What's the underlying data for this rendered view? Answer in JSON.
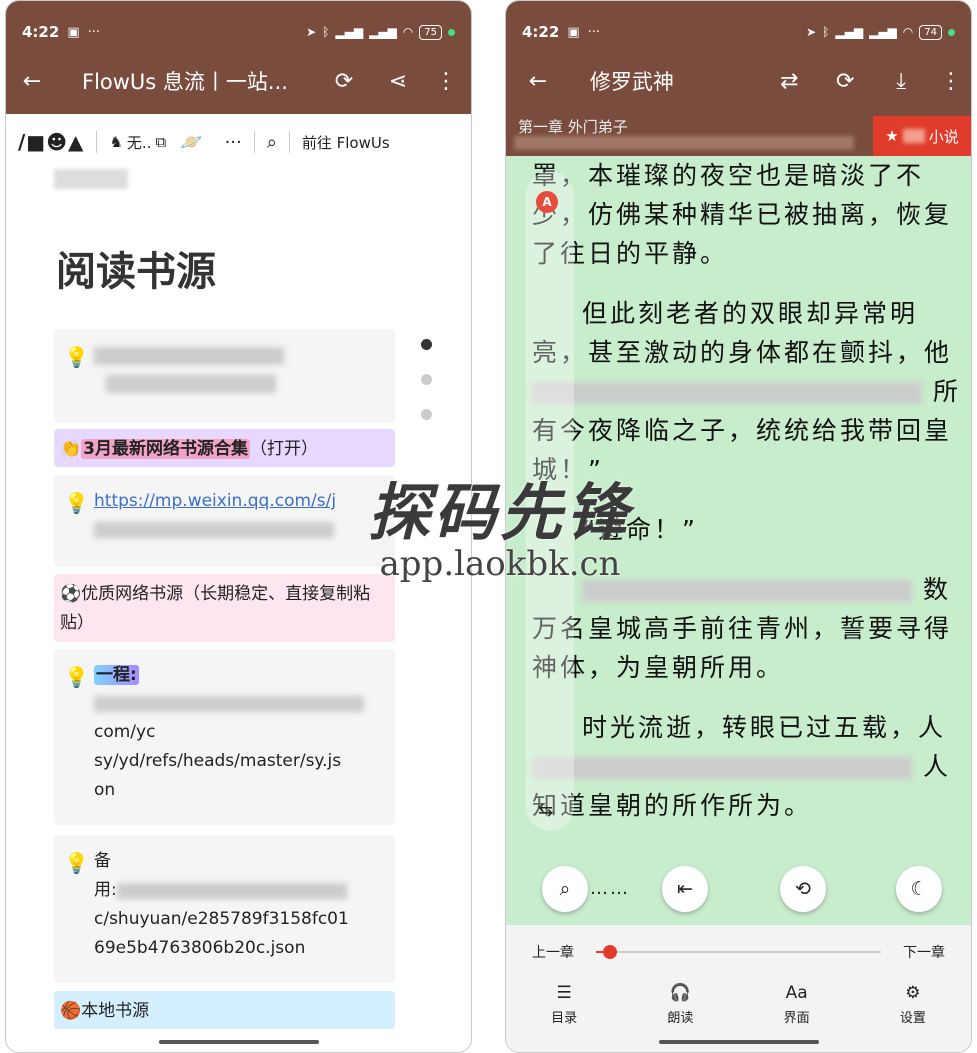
{
  "left": {
    "status": {
      "time": "4:22",
      "battery": "75"
    },
    "toolbar": {
      "title": "FlowUs 息流丨一站..."
    },
    "webbar": {
      "logo": "/■☻▲",
      "crumb": "无..",
      "goto": "前往 FlowUs"
    },
    "page_title": "阅读书源",
    "blocks": {
      "b2_label": "3月最新网络书源合集",
      "b2_suffix": "（打开）",
      "b3_link": "https://mp.weixin.qq.com/s/j",
      "b4_label": "⚽优质网络书源（长期稳定、直接复制粘贴）",
      "b5_label": "一程:",
      "b5_line2": "com/yc",
      "b5_line3": "sy/yd/refs/heads/master/sy.js",
      "b5_line4": "on",
      "b6_line1": "备",
      "b6_line2": "用:",
      "b6_line3": "c/shuyuan/e285789f3158fc01",
      "b6_line4": "69e5b4763806b20c.json",
      "b7_label": "🏀本地书源"
    }
  },
  "right": {
    "status": {
      "time": "4:22",
      "battery": "74"
    },
    "toolbar": {
      "title": "修罗武神"
    },
    "chapter": "第一章 外门弟子",
    "fav_label": "小说",
    "paragraphs": {
      "p1": "罩，本璀璨的夜空也是暗淡了不少，仿佛某种精华已被抽离，恢复了往日的平静。",
      "p2a": "但此刻老者的双眼却异常明亮，甚至激动的身体都在颤抖，他",
      "p2b": "所有今夜降临之子，统统给我带回皇城！”",
      "p3": "“遵命！”",
      "p4b": "数万名皇城高手前往青州，誓要寻得神体，为皇朝所用。",
      "p5a": "时光流逝，转眼已过五载，人",
      "p5b": "人知道皇朝的所作所为。"
    },
    "fab_dots": "……",
    "progress": {
      "prev": "上一章",
      "next": "下一章",
      "value": 0.05
    },
    "nav": [
      {
        "label": "目录"
      },
      {
        "label": "朗读"
      },
      {
        "label": "界面"
      },
      {
        "label": "设置"
      }
    ]
  },
  "watermark": {
    "main": "探码先锋",
    "sub": "app.laokbk.cn"
  }
}
